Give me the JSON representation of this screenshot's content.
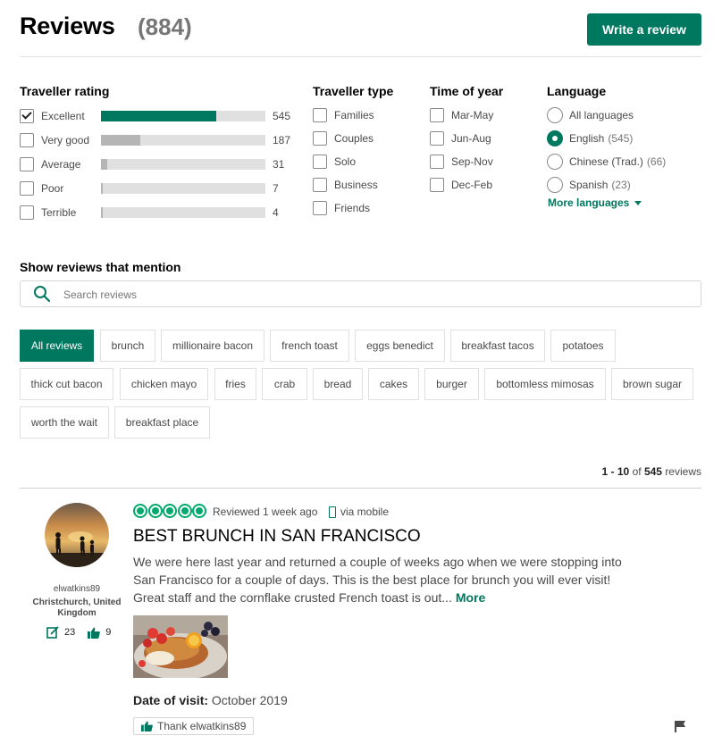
{
  "header": {
    "title": "Reviews",
    "count": "(884)",
    "write_review_label": "Write a review"
  },
  "colors": {
    "accent": "#00775f",
    "bubble": "#00aa6c",
    "bar_track": "#e0e0e0",
    "bar_grey": "#b5b5b5"
  },
  "filters": {
    "traveller_rating": {
      "title": "Traveller rating",
      "items": [
        {
          "label": "Excellent",
          "count": "545",
          "fraction": 0.7,
          "checked": true,
          "highlight": true
        },
        {
          "label": "Very good",
          "count": "187",
          "fraction": 0.24,
          "checked": false,
          "highlight": false
        },
        {
          "label": "Average",
          "count": "31",
          "fraction": 0.04,
          "checked": false,
          "highlight": false
        },
        {
          "label": "Poor",
          "count": "7",
          "fraction": 0.01,
          "checked": false,
          "highlight": false
        },
        {
          "label": "Terrible",
          "count": "4",
          "fraction": 0.008,
          "checked": false,
          "highlight": false
        }
      ]
    },
    "traveller_type": {
      "title": "Traveller type",
      "items": [
        "Families",
        "Couples",
        "Solo",
        "Business",
        "Friends"
      ]
    },
    "time_of_year": {
      "title": "Time of year",
      "items": [
        "Mar-May",
        "Jun-Aug",
        "Sep-Nov",
        "Dec-Feb"
      ]
    },
    "language": {
      "title": "Language",
      "items": [
        {
          "label": "All languages",
          "count": "",
          "selected": false
        },
        {
          "label": "English",
          "count": "(545)",
          "selected": true
        },
        {
          "label": "Chinese (Trad.)",
          "count": "(66)",
          "selected": false
        },
        {
          "label": "Spanish",
          "count": "(23)",
          "selected": false
        }
      ],
      "more_label": "More languages"
    }
  },
  "mentions": {
    "title": "Show reviews that mention",
    "search_placeholder": "Search reviews",
    "tags": [
      "All reviews",
      "brunch",
      "millionaire bacon",
      "french toast",
      "eggs benedict",
      "breakfast tacos",
      "potatoes",
      "thick cut bacon",
      "chicken mayo",
      "fries",
      "crab",
      "bread",
      "cakes",
      "burger",
      "bottomless mimosas",
      "brown sugar",
      "worth the wait",
      "breakfast place"
    ],
    "active_tag": "All reviews"
  },
  "paging": {
    "range": "1 - 10",
    "of": "of",
    "total": "545",
    "suffix": "reviews"
  },
  "review": {
    "user": {
      "name": "elwatkins89",
      "location": "Christchurch, United Kingdom",
      "contributions": "23",
      "helpful_votes": "9"
    },
    "rating": 5,
    "reviewed": "Reviewed 1 week ago",
    "via": "via mobile",
    "title": "BEST BRUNCH IN SAN FRANCISCO",
    "body": "We were here last year and returned a couple of weeks ago when we were stopping into San Francisco for a couple of days. This is the best place for brunch you will ever visit! Great staff and the cornflake crusted French toast is out...",
    "more_label": "More",
    "date_label": "Date of visit:",
    "date_value": "October 2019",
    "thank_label": "Thank elwatkins89"
  }
}
